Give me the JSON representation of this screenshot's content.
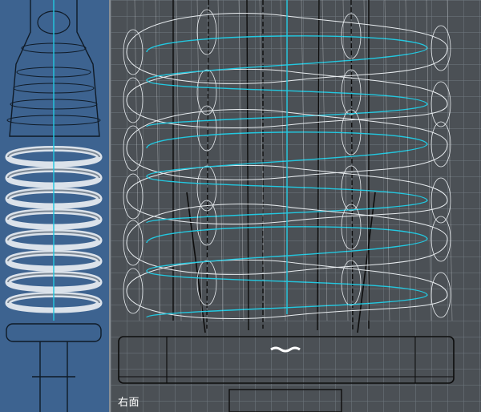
{
  "viewports": {
    "left": {
      "bg_color": "#3d6390"
    },
    "right": {
      "label": "右面",
      "bg_color": "#4b5055"
    }
  },
  "colors": {
    "wire": "#e8ecef",
    "wire_dark": "#0d0d0d",
    "axis": "#22c8e0"
  },
  "icons": [
    "spring-model-icon"
  ]
}
